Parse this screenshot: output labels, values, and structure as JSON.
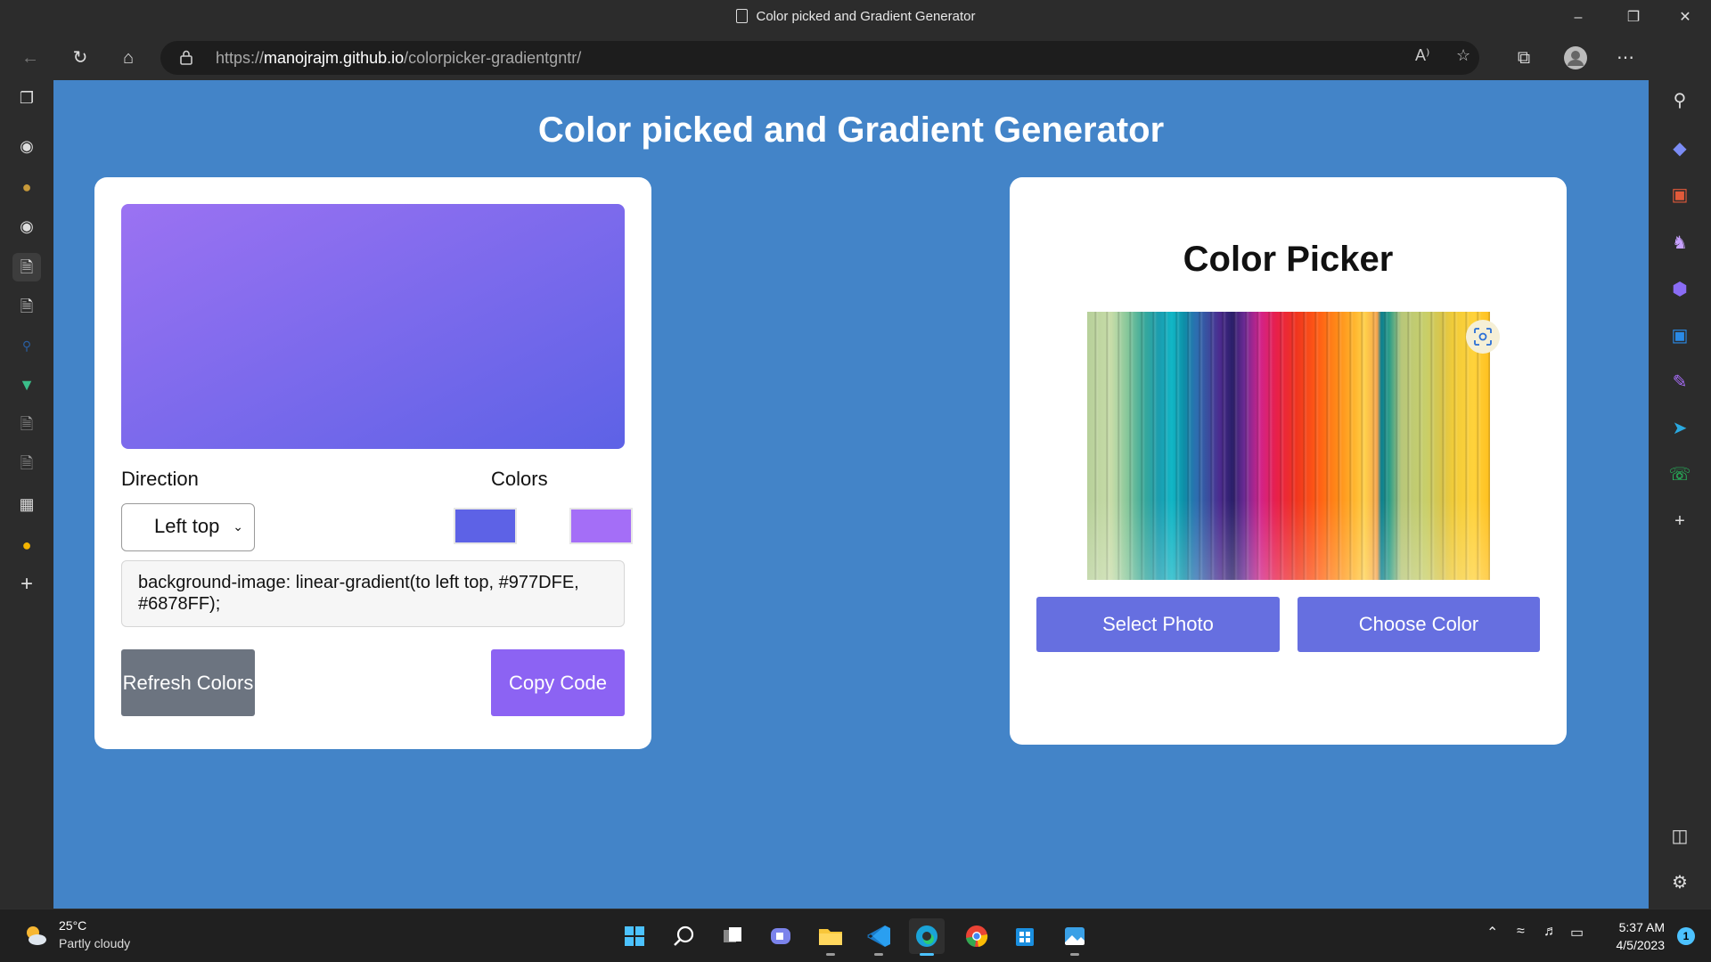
{
  "window": {
    "tab_title": "Color picked and Gradient Generator"
  },
  "browser": {
    "url_prefix": "https://",
    "url_host": "manojrajm.github.io",
    "url_path": "/colorpicker-gradientgntr/"
  },
  "page": {
    "title": "Color picked and Gradient Generator",
    "gradient_card": {
      "direction_label": "Direction",
      "colors_label": "Colors",
      "direction_value": "Left top",
      "color_1": "#5d62e6",
      "color_2": "#a46ef7",
      "code": "background-image: linear-gradient(to left top, #977DFE, #6878FF);",
      "refresh_label": "Refresh Colors",
      "copy_label": "Copy Code"
    },
    "picker_card": {
      "title": "Color Picker",
      "select_photo_label": "Select Photo",
      "choose_color_label": "Choose Color"
    }
  },
  "taskbar": {
    "temperature": "25°C",
    "condition": "Partly cloudy",
    "time": "5:37 AM",
    "date": "4/5/2023",
    "notification_count": "1"
  },
  "colors": {
    "page_bg": "#4384c8",
    "button_primary": "#666fe0",
    "copy_button": "#8c63f3",
    "refresh_button": "#6c7480"
  }
}
